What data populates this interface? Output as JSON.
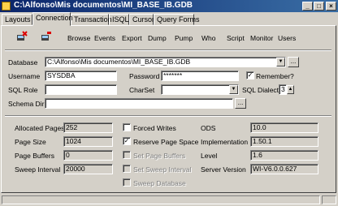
{
  "window": {
    "title": "C:\\Alfonso\\Mis documentos\\MI_BASE_IB.GDB"
  },
  "tabs": [
    {
      "label": "Layouts"
    },
    {
      "label": "Connection"
    },
    {
      "label": "Transaction"
    },
    {
      "label": "ISQL"
    },
    {
      "label": "Cursor"
    },
    {
      "label": "Query Forms"
    }
  ],
  "toolbar": {
    "items": [
      "Browse",
      "Events",
      "Export",
      "Dump",
      "Pump",
      "Who",
      "Script",
      "Monitor",
      "Users"
    ]
  },
  "connection": {
    "database_label": "Database",
    "database_value": "C:\\Alfonso\\Mis documentos\\MI_BASE_IB.GDB",
    "browse_button": "...",
    "username_label": "Username",
    "username_value": "SYSDBA",
    "password_label": "Password",
    "password_value": "*******",
    "remember_label": "Remember?",
    "remember_checked": "✓",
    "sqlrole_label": "SQL Role",
    "sqlrole_value": "",
    "charset_label": "CharSet",
    "charset_value": "",
    "sqldialect_label": "SQL Dialect",
    "sqldialect_value": "3",
    "schemadir_label": "Schema Dir",
    "schemadir_value": "",
    "schemadir_button": "..."
  },
  "info": {
    "allocated_pages_label": "Allocated Pages",
    "allocated_pages_value": "252",
    "page_size_label": "Page Size",
    "page_size_value": "1024",
    "page_buffers_label": "Page Buffers",
    "page_buffers_value": "0",
    "sweep_interval_label": "Sweep Interval",
    "sweep_interval_value": "20000",
    "forced_writes_label": "Forced Writes",
    "reserve_page_space_label": "Reserve Page Space",
    "reserve_checked": "✓",
    "set_page_buffers_label": "Set Page Buffers",
    "set_sweep_interval_label": "Set Sweep Interval",
    "sweep_database_label": "Sweep Database",
    "ods_label": "ODS",
    "ods_value": "10.0",
    "implementation_label": "Implementation",
    "implementation_value": "1.50.1",
    "level_label": "Level",
    "level_value": "1.6",
    "server_version_label": "Server Version",
    "server_version_value": "WI-V6.0.0.627"
  },
  "colors": {
    "titlebar_start": "#0a246a",
    "titlebar_end": "#3a6ea5",
    "face": "#d4d0c8"
  }
}
